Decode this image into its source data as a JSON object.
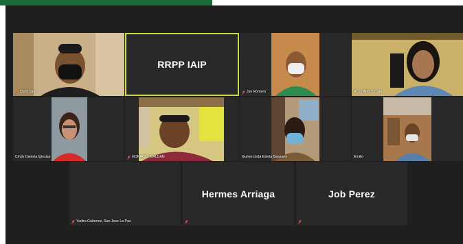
{
  "window": {
    "accent_bar_color": "#1e6b3a",
    "active_speaker_border": "#c8d94a"
  },
  "participants": [
    {
      "name": "Darlo lara",
      "muted": true
    },
    {
      "name": "RRPP IAIP",
      "muted": false,
      "active": true,
      "video": false
    },
    {
      "name": "Jse Romero",
      "muted": true
    },
    {
      "name": "Rosa Arrechavala",
      "muted": false
    },
    {
      "name": "Cindy Daniela Iglesias",
      "muted": false
    },
    {
      "name": "HORACIO WALDAN",
      "muted": true
    },
    {
      "name": "Gumercinda Estela Bejarano",
      "muted": false
    },
    {
      "name": "Emilio",
      "muted": false
    },
    {
      "name": "Yadira Gutierrez, San Jose La Paz",
      "muted": true,
      "video": false
    },
    {
      "name": "Hermes Arriaga",
      "muted": true,
      "video": false
    },
    {
      "name": "Job Perez",
      "muted": true,
      "video": false
    }
  ],
  "icons": {
    "mic_off": "mic-off-icon"
  }
}
